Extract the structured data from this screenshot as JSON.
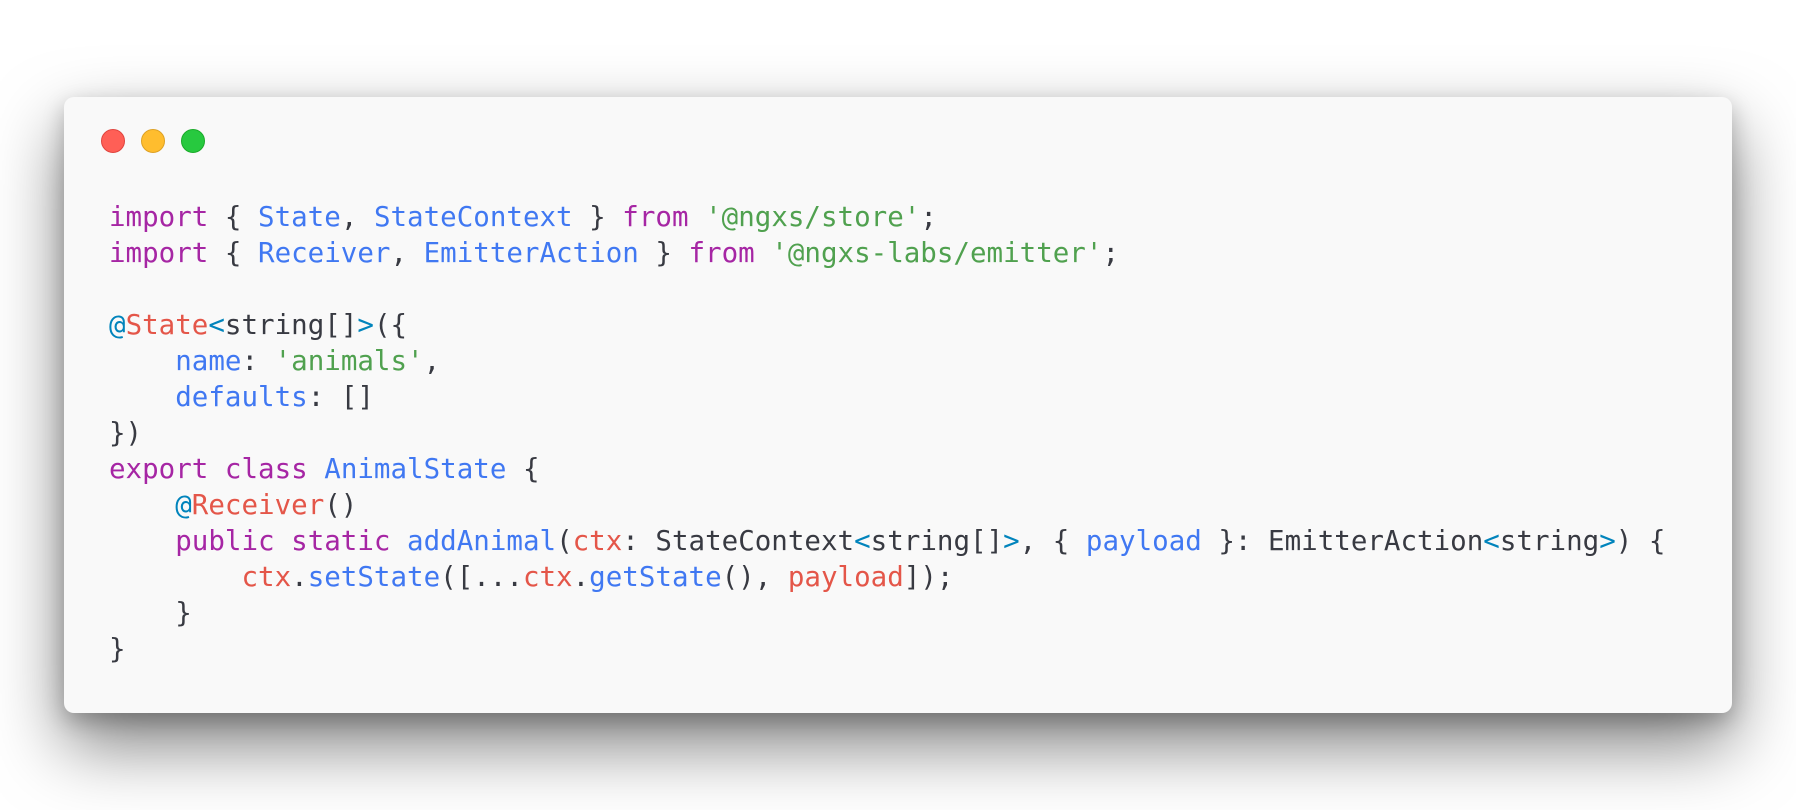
{
  "window": {
    "controls": {
      "close_icon": "close-icon",
      "minimize_icon": "minimize-icon",
      "maximize_icon": "maximize-icon",
      "close_color": "#ff5f56",
      "minimize_color": "#ffbd2e",
      "maximize_color": "#27c93f"
    }
  },
  "code": {
    "lines": [
      [
        [
          "kw",
          "import"
        ],
        [
          "pun",
          " { "
        ],
        [
          "ty",
          "State"
        ],
        [
          "pun",
          ", "
        ],
        [
          "ty",
          "StateContext"
        ],
        [
          "pun",
          " } "
        ],
        [
          "kw",
          "from"
        ],
        [
          "pun",
          " "
        ],
        [
          "str",
          "'@ngxs/store'"
        ],
        [
          "pun",
          ";"
        ]
      ],
      [
        [
          "kw",
          "import"
        ],
        [
          "pun",
          " { "
        ],
        [
          "ty",
          "Receiver"
        ],
        [
          "pun",
          ", "
        ],
        [
          "ty",
          "EmitterAction"
        ],
        [
          "pun",
          " } "
        ],
        [
          "kw",
          "from"
        ],
        [
          "pun",
          " "
        ],
        [
          "str",
          "'@ngxs-labs/emitter'"
        ],
        [
          "pun",
          ";"
        ]
      ],
      [],
      [
        [
          "at",
          "@"
        ],
        [
          "dec",
          "State"
        ],
        [
          "ang",
          "<"
        ],
        [
          "pun",
          "string[]"
        ],
        [
          "ang",
          ">"
        ],
        [
          "pun",
          "({"
        ]
      ],
      [
        [
          "pun",
          "    "
        ],
        [
          "prop",
          "name"
        ],
        [
          "pun",
          ": "
        ],
        [
          "str",
          "'animals'"
        ],
        [
          "pun",
          ","
        ]
      ],
      [
        [
          "pun",
          "    "
        ],
        [
          "prop",
          "defaults"
        ],
        [
          "pun",
          ": []"
        ]
      ],
      [
        [
          "pun",
          "})"
        ]
      ],
      [
        [
          "kw",
          "export"
        ],
        [
          "pun",
          " "
        ],
        [
          "kw",
          "class"
        ],
        [
          "pun",
          " "
        ],
        [
          "ty",
          "AnimalState"
        ],
        [
          "pun",
          " {"
        ]
      ],
      [
        [
          "pun",
          "    "
        ],
        [
          "at",
          "@"
        ],
        [
          "dec",
          "Receiver"
        ],
        [
          "pun",
          "()"
        ]
      ],
      [
        [
          "pun",
          "    "
        ],
        [
          "kw",
          "public"
        ],
        [
          "pun",
          " "
        ],
        [
          "kw",
          "static"
        ],
        [
          "pun",
          " "
        ],
        [
          "fn",
          "addAnimal"
        ],
        [
          "pun",
          "("
        ],
        [
          "var",
          "ctx"
        ],
        [
          "pun",
          ": StateContext"
        ],
        [
          "ang",
          "<"
        ],
        [
          "pun",
          "string[]"
        ],
        [
          "ang",
          ">"
        ],
        [
          "pun",
          ", { "
        ],
        [
          "prop",
          "payload"
        ],
        [
          "pun",
          " }: EmitterAction"
        ],
        [
          "ang",
          "<"
        ],
        [
          "pun",
          "string"
        ],
        [
          "ang",
          ">"
        ],
        [
          "pun",
          ") {"
        ]
      ],
      [
        [
          "pun",
          "        "
        ],
        [
          "var",
          "ctx"
        ],
        [
          "pun",
          "."
        ],
        [
          "fn",
          "setState"
        ],
        [
          "pun",
          "([..."
        ],
        [
          "var",
          "ctx"
        ],
        [
          "pun",
          "."
        ],
        [
          "fn",
          "getState"
        ],
        [
          "pun",
          "(), "
        ],
        [
          "var",
          "payload"
        ],
        [
          "pun",
          "]);"
        ]
      ],
      [
        [
          "pun",
          "    }"
        ]
      ],
      [
        [
          "pun",
          "}"
        ]
      ]
    ]
  }
}
